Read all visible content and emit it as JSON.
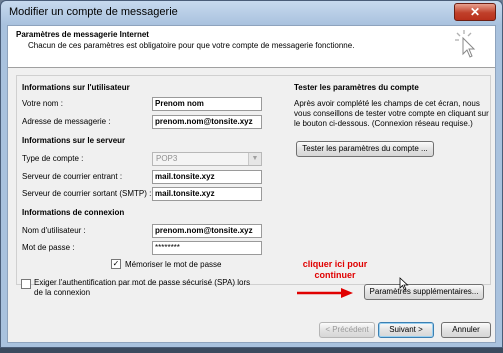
{
  "window": {
    "title": "Modifier un compte de messagerie",
    "close_glyph": "✕"
  },
  "header": {
    "title": "Paramètres de messagerie Internet",
    "subtitle": "Chacun de ces paramètres est obligatoire pour que votre compte de messagerie fonctionne."
  },
  "user_info": {
    "heading": "Informations sur l'utilisateur",
    "name_label": "Votre nom :",
    "name_value": "Prenom nom",
    "email_label": "Adresse de messagerie :",
    "email_value": "prenom.nom@tonsite.xyz"
  },
  "server_info": {
    "heading": "Informations sur le serveur",
    "account_type_label": "Type de compte :",
    "account_type_value": "POP3",
    "incoming_label": "Serveur de courrier entrant :",
    "incoming_value": "mail.tonsite.xyz",
    "outgoing_label": "Serveur de courrier sortant (SMTP) :",
    "outgoing_value": "mail.tonsite.xyz"
  },
  "login_info": {
    "heading": "Informations de connexion",
    "username_label": "Nom d'utilisateur :",
    "username_value": "prenom.nom@tonsite.xyz",
    "password_label": "Mot de passe :",
    "password_value": "********",
    "remember_label": "Mémoriser le mot de passe",
    "remember_checked": true,
    "spa_label_line1": "Exiger l'authentification par mot de passe sécurisé (SPA) lors",
    "spa_label_line2": "de la connexion",
    "spa_checked": false
  },
  "test_section": {
    "heading": "Tester les paramètres du compte",
    "desc_line1": "Après avoir complété les champs de cet écran, nous",
    "desc_line2": "vous conseillons de tester votre compte en cliquant sur",
    "desc_line3": "le bouton ci-dessous. (Connexion réseau requise.)",
    "test_button": "Tester les paramètres du compte ..."
  },
  "annotation": {
    "line1": "cliquer ici pour",
    "line2": "continuer",
    "color": "#e00000"
  },
  "more_settings_button": "Paramètres supplémentaires...",
  "footer": {
    "prev_button": "< Précédent",
    "next_button": "Suivant >",
    "cancel_button": "Annuler"
  },
  "icons": {
    "close": "close-icon",
    "header": "cursor-click-icon",
    "dropdown": "chevron-down-icon",
    "arrow": "red-arrow-icon",
    "pointer": "mouse-pointer-icon"
  }
}
